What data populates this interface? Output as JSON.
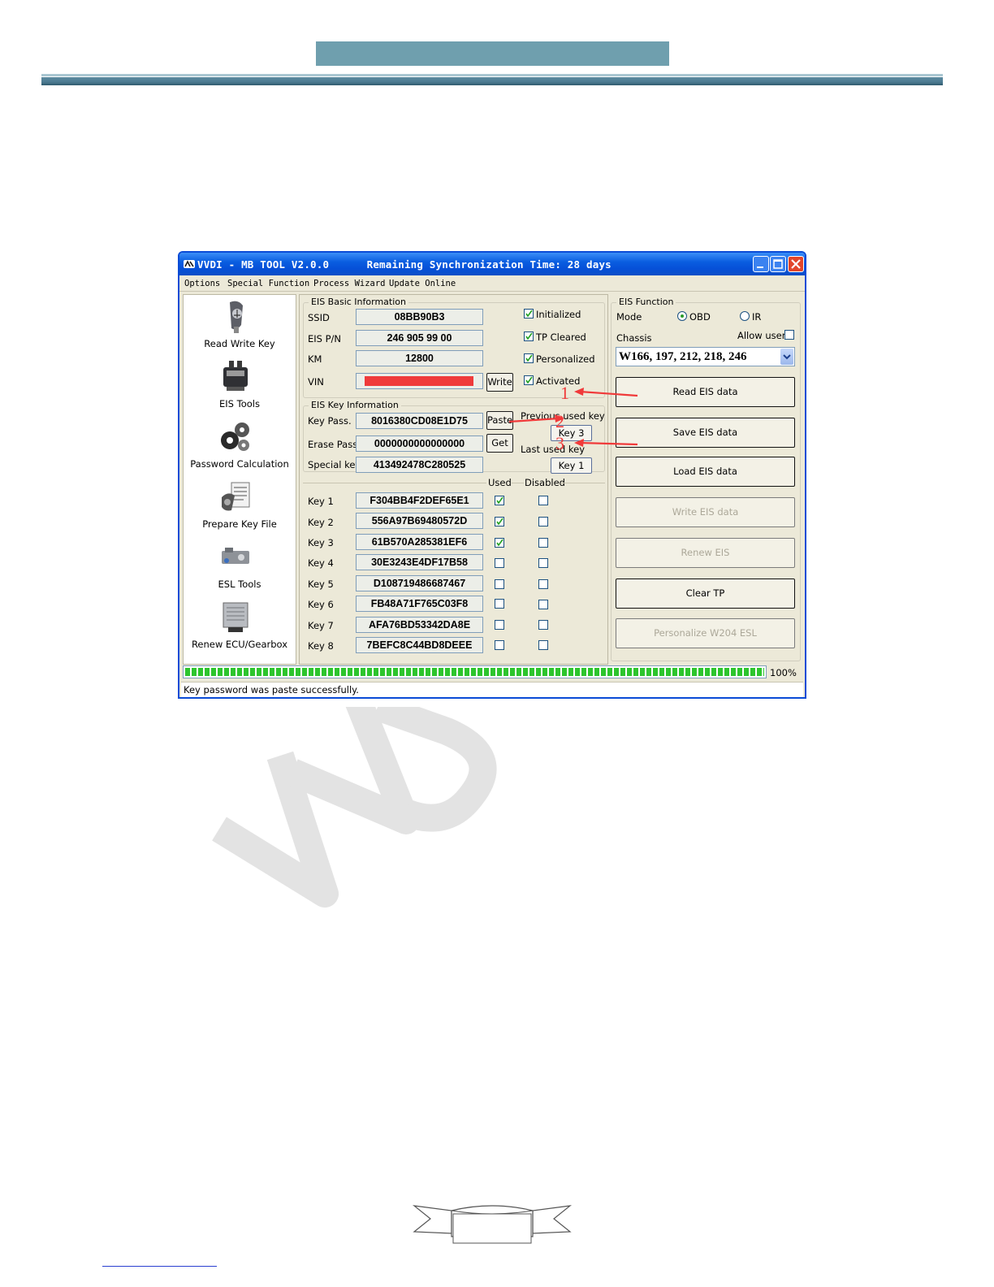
{
  "window": {
    "title": "VVDI - MB TOOL V2.0.0      Remaining Synchronization Time: 28 days"
  },
  "menu": [
    "Options",
    "Special Function",
    "Process Wizard",
    "Update Online"
  ],
  "sidebar": {
    "items": [
      {
        "label": "Read Write Key",
        "icon": "key-fob-icon"
      },
      {
        "label": "EIS Tools",
        "icon": "eis-module-icon",
        "selected": true
      },
      {
        "label": "Password Calculation",
        "icon": "gears-icon"
      },
      {
        "label": "Prepare Key File",
        "icon": "key-file-icon"
      },
      {
        "label": "ESL Tools",
        "icon": "esl-lock-icon"
      },
      {
        "label": "Renew ECU/Gearbox",
        "icon": "ecu-box-icon"
      }
    ]
  },
  "eis_basic": {
    "title": "EIS Basic Information",
    "ssid_label": "SSID",
    "ssid": "08BB90B3",
    "pn_label": "EIS P/N",
    "pn": "246 905 99 00",
    "km_label": "KM",
    "km": "12800",
    "vin_label": "VIN",
    "vin": "",
    "write_label": "Write",
    "flags": [
      {
        "label": "Initialized",
        "checked": true
      },
      {
        "label": "TP Cleared",
        "checked": true
      },
      {
        "label": "Personalized",
        "checked": true
      },
      {
        "label": "Activated",
        "checked": true
      }
    ]
  },
  "eis_key": {
    "title": "EIS Key Information",
    "keypass_label": "Key Pass.",
    "keypass": "8016380CD08E1D75",
    "erasepass_label": "Erase Pass.",
    "erasepass": "0000000000000000",
    "special_label": "Special key",
    "special": "413492478C280525",
    "paste_label": "Paste",
    "get_label": "Get",
    "prev_used_label": "Previous used key",
    "prev_used": "Key 3",
    "last_used_label": "Last used key",
    "last_used": "Key 1",
    "used_header": "Used",
    "disabled_header": "Disabled",
    "keys": [
      {
        "label": "Key 1",
        "value": "F304BB4F2DEF65E1",
        "used": true,
        "disabled": false
      },
      {
        "label": "Key 2",
        "value": "556A97B69480572D",
        "used": true,
        "disabled": false
      },
      {
        "label": "Key 3",
        "value": "61B570A285381EF6",
        "used": true,
        "disabled": false
      },
      {
        "label": "Key 4",
        "value": "30E3243E4DF17B58",
        "used": false,
        "disabled": false
      },
      {
        "label": "Key 5",
        "value": "D108719486687467",
        "used": false,
        "disabled": false
      },
      {
        "label": "Key 6",
        "value": "FB48A71F765C03F8",
        "used": false,
        "disabled": false
      },
      {
        "label": "Key 7",
        "value": "AFA76BD53342DA8E",
        "used": false,
        "disabled": false
      },
      {
        "label": "Key 8",
        "value": "7BEFC8C44BD8DEEE",
        "used": false,
        "disabled": false
      }
    ]
  },
  "eis_function": {
    "title": "EIS Function",
    "mode_label": "Mode",
    "mode_options": [
      "OBD",
      "IR"
    ],
    "mode_selected": "OBD",
    "chassis_label": "Chassis",
    "allow_user_label": "Allow user",
    "allow_user": false,
    "chassis_value": "W166, 197, 212, 218, 246",
    "buttons": [
      {
        "label": "Read EIS data",
        "enabled": true
      },
      {
        "label": "Save EIS data",
        "enabled": true
      },
      {
        "label": "Load EIS data",
        "enabled": true
      },
      {
        "label": "Write EIS data",
        "enabled": false
      },
      {
        "label": "Renew EIS",
        "enabled": false
      },
      {
        "label": "Clear TP",
        "enabled": true
      },
      {
        "label": "Personalize W204 ESL",
        "enabled": false
      }
    ]
  },
  "progress": {
    "value": 1.0,
    "text": "100%"
  },
  "status": "Key password was paste successfully.",
  "annotations": [
    "1",
    "2",
    "3"
  ],
  "colors": {
    "annotation": "#f03a3a",
    "titlebar": "#0a5ee0",
    "progress": "#2dc52d",
    "header_bar": "#6f9fae"
  }
}
